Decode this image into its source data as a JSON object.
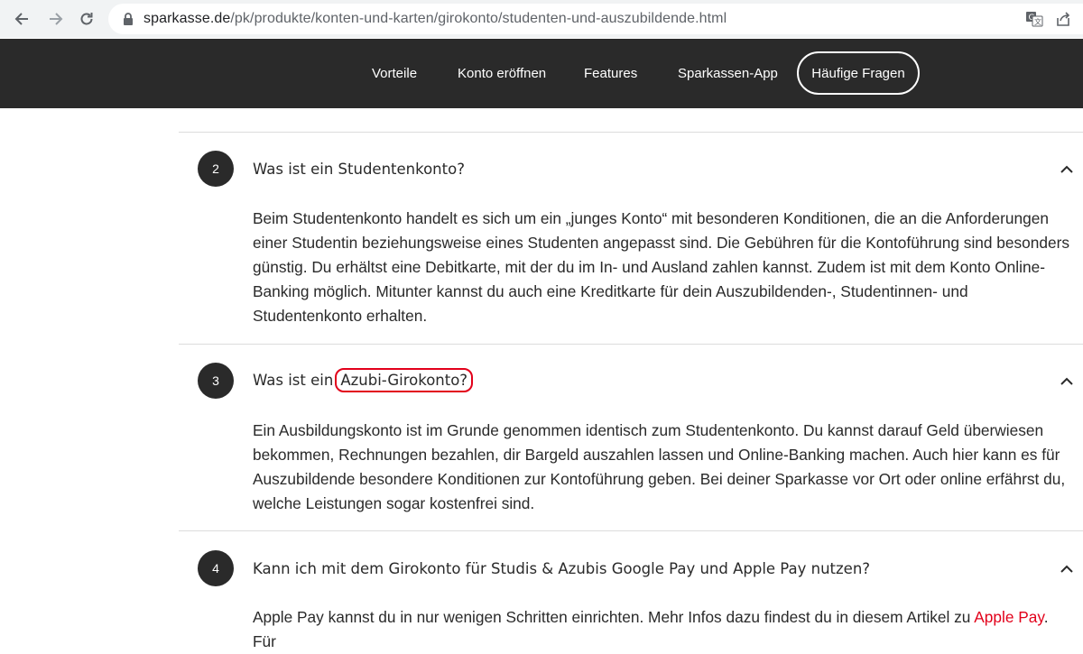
{
  "browser": {
    "url_domain": "sparkasse.de",
    "url_path": "/pk/produkte/konten-und-karten/girokonto/studenten-und-auszubildende.html"
  },
  "nav": {
    "items": [
      "Vorteile",
      "Konto eröffnen",
      "Features",
      "Sparkassen-App"
    ],
    "active": "Häufige Fragen"
  },
  "faq": [
    {
      "number": "2",
      "question": "Was ist ein Studentenkonto?",
      "answer": "Beim Studentenkonto handelt es sich um ein „junges Konto“ mit besonderen Konditionen, die an die Anforderungen einer Studentin beziehungsweise eines Studenten angepasst sind. Die Gebühren für die Kontoführung sind besonders günstig. Du erhältst eine Debitkarte, mit der du im In- und Ausland zahlen kannst. Zudem ist mit dem Konto Online-Banking möglich. Mitunter kannst du auch eine Kreditkarte für dein Auszubildenden-, Studentinnen- und Studentenkonto erhalten."
    },
    {
      "number": "3",
      "question_prefix": "Was ist ein",
      "question_highlight": "Azubi-Girokonto?",
      "answer": "Ein Ausbildungskonto ist im Grunde genommen identisch zum Studentenkonto. Du kannst darauf Geld überwiesen bekommen, Rechnungen bezahlen, dir Bargeld auszahlen lassen und Online-Banking machen. Auch hier kann es für Auszubildende besondere Konditionen zur Kontoführung geben. Bei deiner Sparkasse vor Ort oder online erfährst du, welche Leistungen sogar kostenfrei sind."
    },
    {
      "number": "4",
      "question": "Kann ich mit dem Girokonto für Studis & Azubis Google Pay und Apple Pay nutzen?",
      "answer_prefix": "Apple Pay kannst du in nur wenigen Schritten einrichten. Mehr Infos dazu findest du in diesem Artikel zu ",
      "answer_link": "Apple Pay",
      "answer_suffix": ". Für"
    }
  ]
}
